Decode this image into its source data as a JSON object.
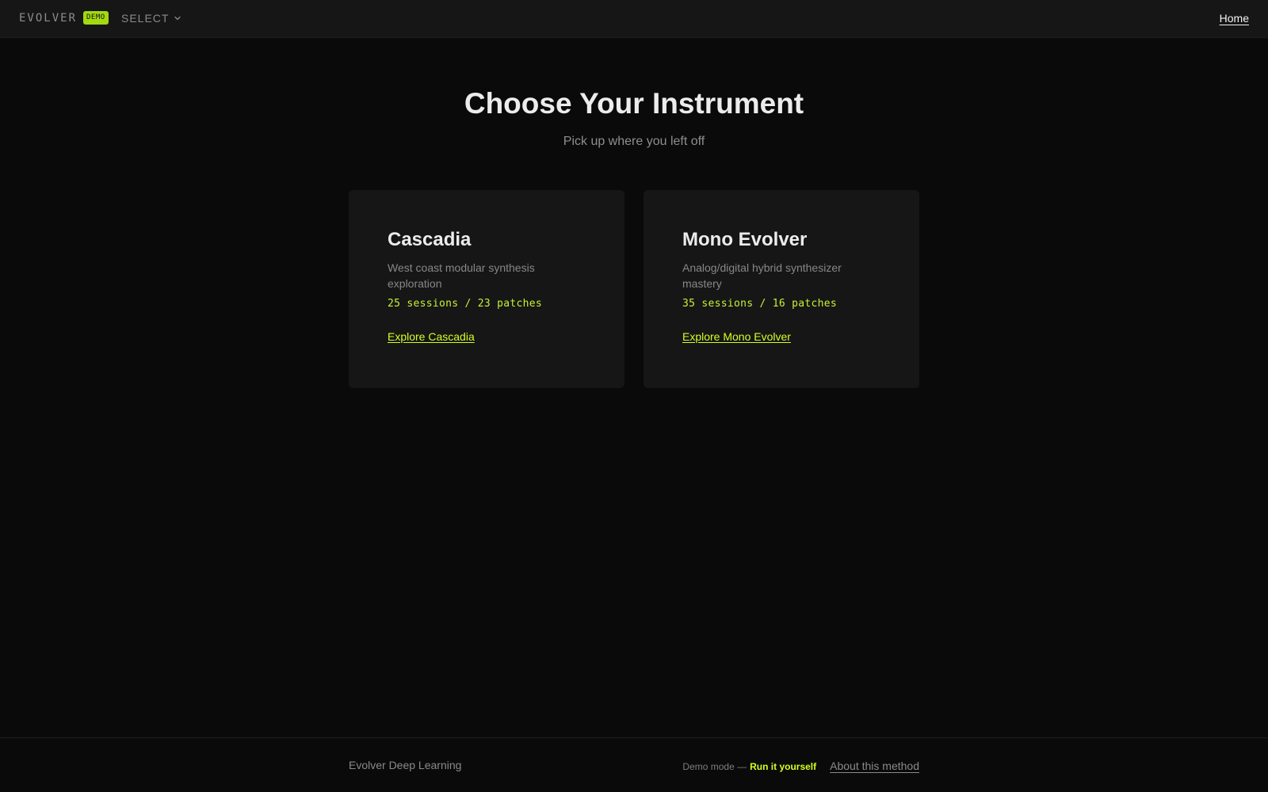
{
  "nav": {
    "brand": "EVOLVER",
    "badge": "DEMO",
    "select_label": "SELECT",
    "select_icon": "chevron-down-icon",
    "home_link": "Home"
  },
  "hero": {
    "title": "Choose Your Instrument",
    "subtitle": "Pick up where you left off"
  },
  "cards": [
    {
      "title": "Cascadia",
      "description": "West coast modular synthesis exploration",
      "stats": "25 sessions / 23 patches",
      "link": "Explore Cascadia"
    },
    {
      "title": "Mono Evolver",
      "description": "Analog/digital hybrid synthesizer mastery",
      "stats": "35 sessions / 16 patches",
      "link": "Explore Mono Evolver"
    }
  ],
  "footer": {
    "brand": "Evolver Deep Learning",
    "demo_mode": "Demo mode —",
    "run_link": "Run it yourself",
    "about_link": "About this method"
  },
  "colors": {
    "background": "#0a0a0a",
    "surface": "#161616",
    "accent": "#d4ff1f",
    "badge": "#a3d911"
  }
}
